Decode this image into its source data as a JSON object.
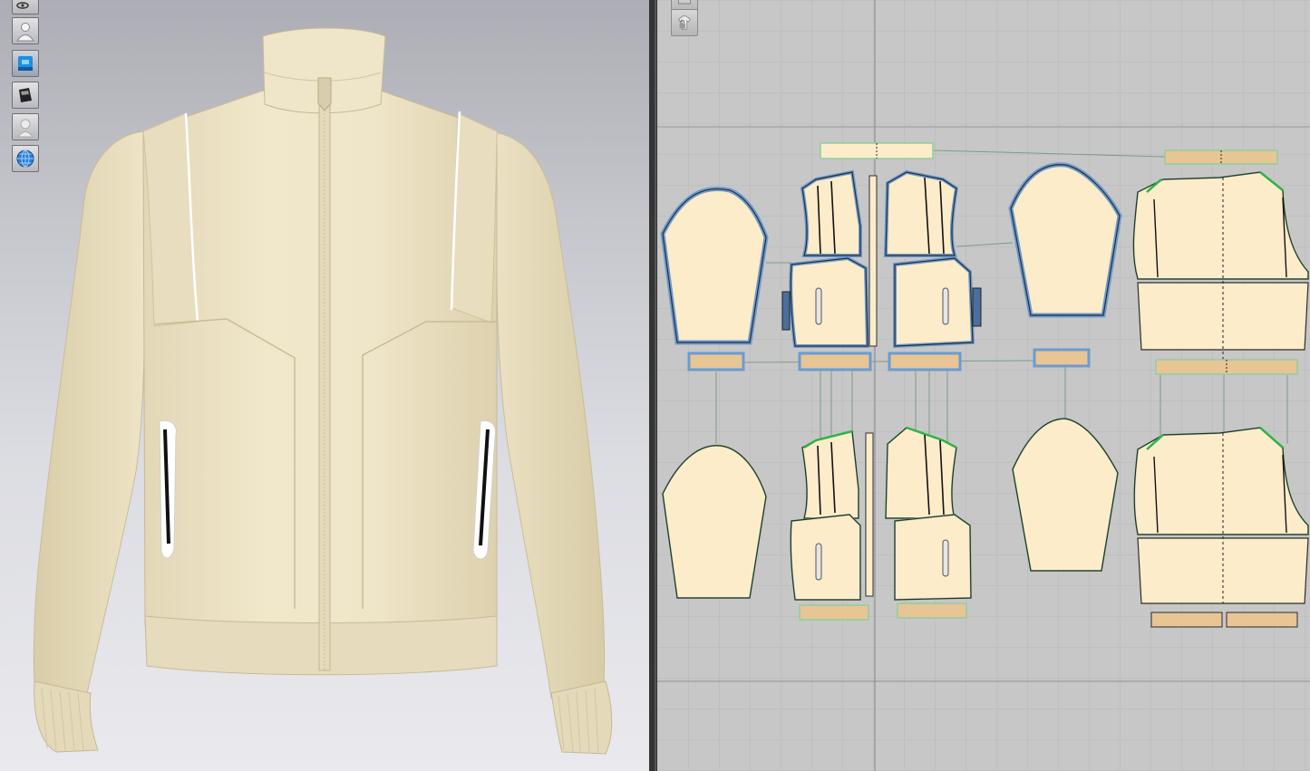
{
  "window": {
    "panes": [
      "3d-avatar-window",
      "2d-pattern-window"
    ]
  },
  "toolbar3d": {
    "buttons": [
      {
        "icon": "show-hide-icon",
        "state": "default"
      },
      {
        "icon": "avatar-icon",
        "state": "default"
      },
      {
        "icon": "garment-render-icon",
        "state": "active"
      },
      {
        "icon": "fabric-texture-icon",
        "state": "default"
      },
      {
        "icon": "avatar-silhouette-icon",
        "state": "default"
      },
      {
        "icon": "environment-globe-icon",
        "state": "default"
      }
    ]
  },
  "toolbar2d": {
    "buttons": [
      {
        "icon": "pattern-view-icon",
        "state": "default"
      },
      {
        "icon": "lock-garment-icon",
        "state": "default"
      }
    ]
  },
  "colors": {
    "fabric": "#ede3c6",
    "fabric_shadow": "#d4c8a5",
    "pattern_fill": "#fdecc9",
    "pattern_outline": "#2d2d2d",
    "selected_outline": "#6b9bd2",
    "seam_green": "#2fb34a",
    "band_fill": "#e8c594",
    "grid_bg": "#c7c7c7"
  }
}
